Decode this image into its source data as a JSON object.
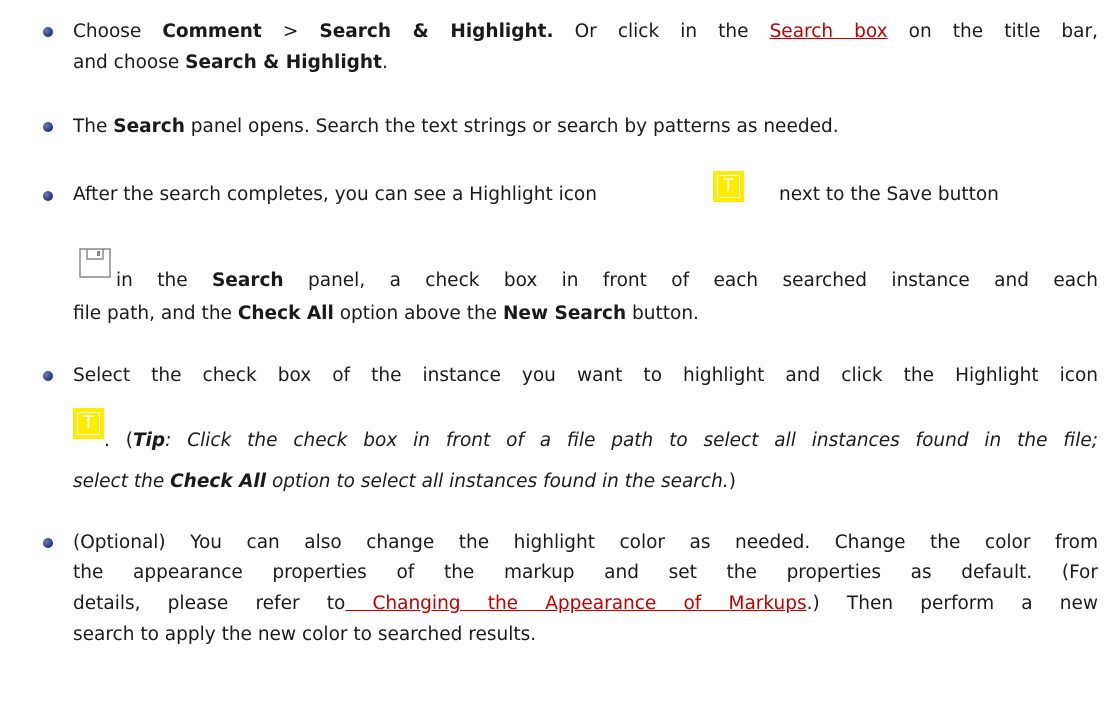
{
  "items": [
    {
      "line1": {
        "t1": "Choose ",
        "b1": "Comment",
        "t2": " > ",
        "b2": "Search & Highlight.",
        "t3": " Or click in the ",
        "link": "Search box",
        "t4": " on the title bar,"
      },
      "line2": {
        "t1": "and choose ",
        "b1": "Search & Highlight",
        "t2": "."
      }
    },
    {
      "line1": {
        "t1": "The ",
        "b1": "Search",
        "t2": " panel opens. Search the text strings or search by patterns as needed."
      }
    },
    {
      "line1": {
        "t1": "After the search completes, you can see a Highlight icon",
        "t2": "next to the Save button"
      },
      "line2": {
        "t1": "in the ",
        "b1": "Search",
        "t2": " panel, a check box in front of each searched instance and each"
      },
      "line3": {
        "t1": "file path, and the ",
        "b1": "Check All",
        "t2": " option above the ",
        "b2": "New Search",
        "t3": " button."
      }
    },
    {
      "line1": {
        "t1": "Select the check box of the instance you want to highlight and click the Highlight icon"
      },
      "line2": {
        "t1": ". (",
        "b1": "Tip",
        "t2": ": Click the check box in front of a file path to select all instances found in the file;"
      },
      "line3": {
        "t1": "select the ",
        "b1": "Check All",
        "t2": " option to select all instances found in the search.",
        "t3": ")"
      }
    },
    {
      "line1": {
        "t1": "(Optional) You can also change the highlight color as needed. Change the color from"
      },
      "line2": {
        "t1": "the appearance properties of the markup and set the properties as default. (For"
      },
      "line3": {
        "t1": "details, please refer to",
        "link": " Changing the Appearance of Markups",
        "t2": ".) Then perform a new"
      },
      "line4": {
        "t1": "search to apply the new color to searched results."
      }
    }
  ],
  "icons": {
    "highlight_glyph": "T"
  },
  "colors": {
    "link": "#c00000",
    "highlight_icon": "#ffeb00",
    "bullet": "#1e2f7a"
  }
}
